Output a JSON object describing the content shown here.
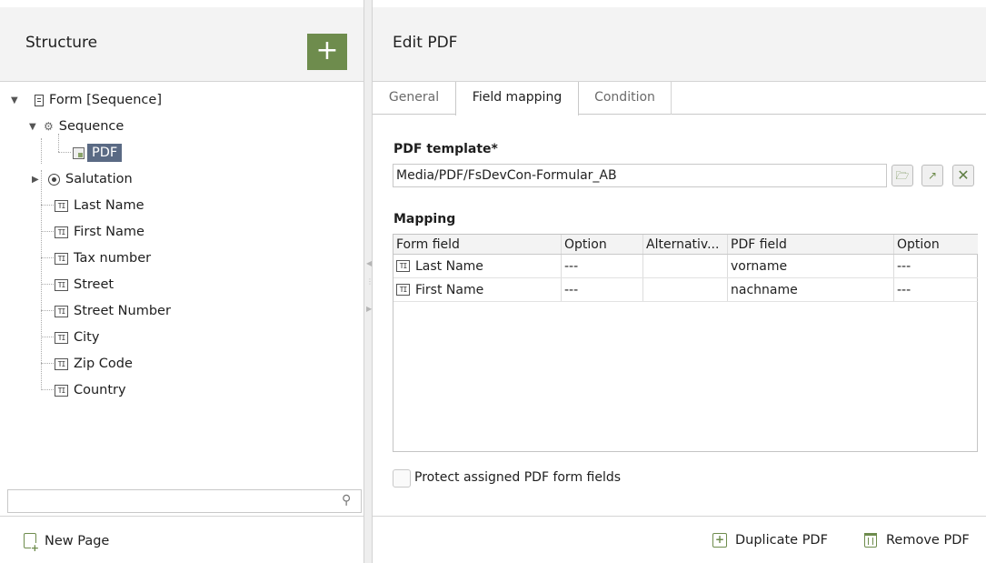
{
  "structure": {
    "title": "Structure",
    "add_button_label": "+",
    "tree": [
      {
        "label": "Form [Sequence]",
        "icon": "form-icon"
      },
      {
        "label": "Sequence",
        "icon": "sequence-icon"
      },
      {
        "label": "PDF",
        "icon": "pdf-icon"
      },
      {
        "label": "Salutation",
        "icon": "radio-icon"
      },
      {
        "label": "Last Name",
        "icon": "text-field-icon"
      },
      {
        "label": "First Name",
        "icon": "text-field-icon"
      },
      {
        "label": "Tax number",
        "icon": "text-field-icon"
      },
      {
        "label": "Street",
        "icon": "text-field-icon"
      },
      {
        "label": "Street Number",
        "icon": "text-field-icon"
      },
      {
        "label": "City",
        "icon": "text-field-icon"
      },
      {
        "label": "Zip Code",
        "icon": "text-field-icon"
      },
      {
        "label": "Country",
        "icon": "text-field-icon"
      }
    ],
    "field_icon_text": "TI",
    "search_value": "",
    "new_page_label": "New Page"
  },
  "edit": {
    "title": "Edit PDF",
    "tabs": [
      "General",
      "Field mapping",
      "Condition"
    ],
    "active_tab": "Field mapping",
    "template_label": "PDF template*",
    "template_value": "Media/PDF/FsDevCon-Formular_AB",
    "mapping_label": "Mapping",
    "mapping": {
      "columns": [
        "Form field",
        "Option",
        "Alternativ...",
        "PDF field",
        "Option"
      ],
      "rows": [
        [
          "Last Name",
          "---",
          "",
          "vorname",
          "---"
        ],
        [
          "First Name",
          "---",
          "",
          "nachname",
          "---"
        ]
      ]
    },
    "protect_label": "Protect assigned PDF form fields",
    "protect_checked": false,
    "duplicate_label": "Duplicate PDF",
    "remove_label": "Remove PDF"
  },
  "colors": {
    "accent": "#6e8c4d",
    "selection": "#5a6a84"
  }
}
